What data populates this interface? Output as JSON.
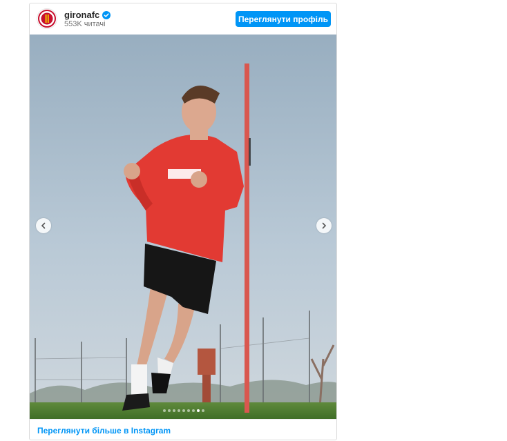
{
  "header": {
    "username": "gironafc",
    "verified_icon": "verified-badge-icon",
    "followers": "553K читачі",
    "view_profile_label": "Переглянути профіль",
    "accent_color": "#0095f6"
  },
  "media": {
    "image_description_icon": "photo",
    "prev_icon": "chevron-left-icon",
    "next_icon": "chevron-right-icon",
    "slide_count": 9,
    "active_slide_index": 7
  },
  "footer": {
    "link_label": "Переглянути більше в Instagram"
  }
}
